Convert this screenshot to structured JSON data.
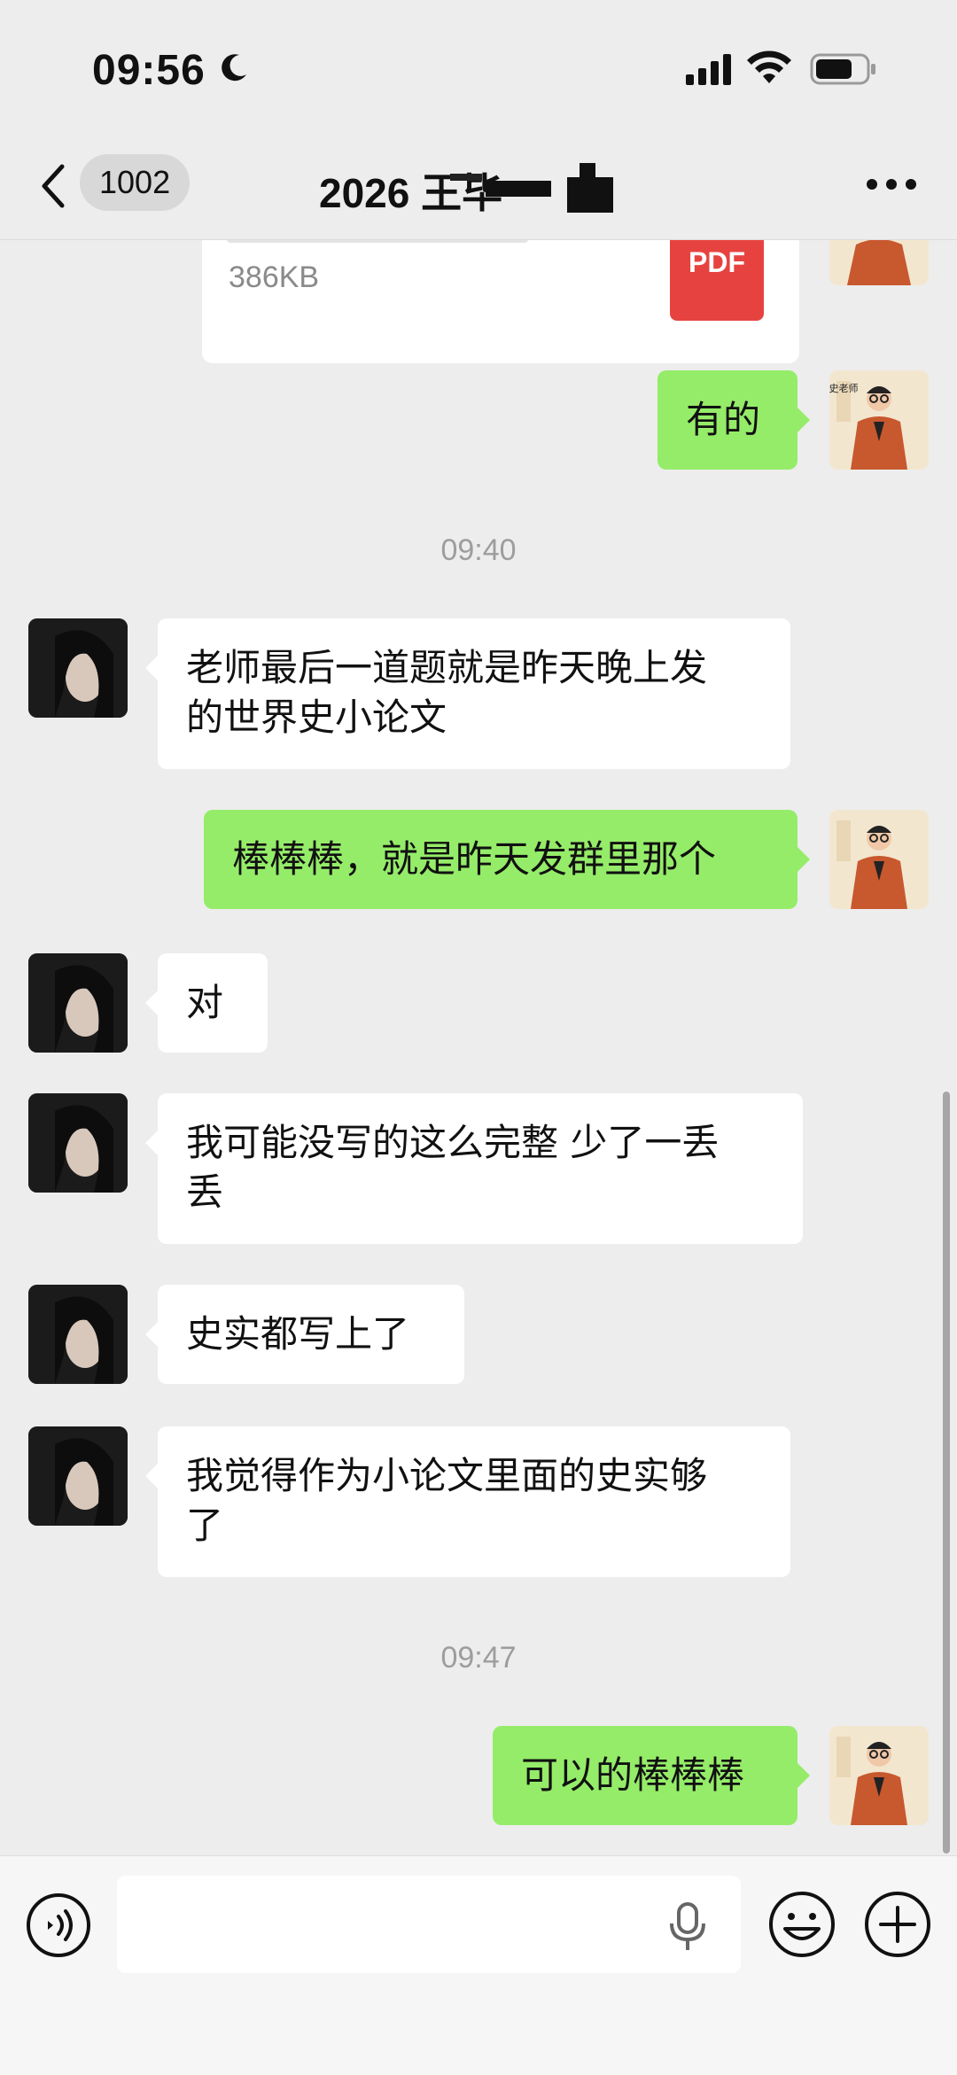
{
  "status_bar": {
    "time": "09:56"
  },
  "nav": {
    "unread_count": "1002",
    "title": "2026 王毕"
  },
  "file_message": {
    "size": "386KB",
    "type_label": "PDF"
  },
  "messages": [
    {
      "sender": "student",
      "text": "老师最后一道题就是昨天晚上发\n的世界史小论文"
    },
    {
      "sender": "teacher",
      "text": "棒棒棒，就是昨天发群里那个"
    },
    {
      "sender": "student",
      "text": "对"
    },
    {
      "sender": "student",
      "text": "我可能没写的这么完整 少了一丢\n丢"
    },
    {
      "sender": "student",
      "text": "史实都写上了"
    },
    {
      "sender": "student",
      "text": "我觉得作为小论文里面的史实够\n了"
    },
    {
      "sender": "teacher",
      "text": "可以的棒棒棒"
    }
  ],
  "first_reply": "有的",
  "timestamps": [
    "09:40",
    "09:47"
  ],
  "teacher_avatar_label": "史老师",
  "colors": {
    "background": "#ededed",
    "outgoing_bubble": "#95ec69",
    "incoming_bubble": "#ffffff",
    "pdf_icon": "#e64340"
  },
  "input_bar": {
    "placeholder": "",
    "icons": [
      "voice-icon",
      "mic-icon",
      "emoji-icon",
      "plus-icon"
    ]
  }
}
